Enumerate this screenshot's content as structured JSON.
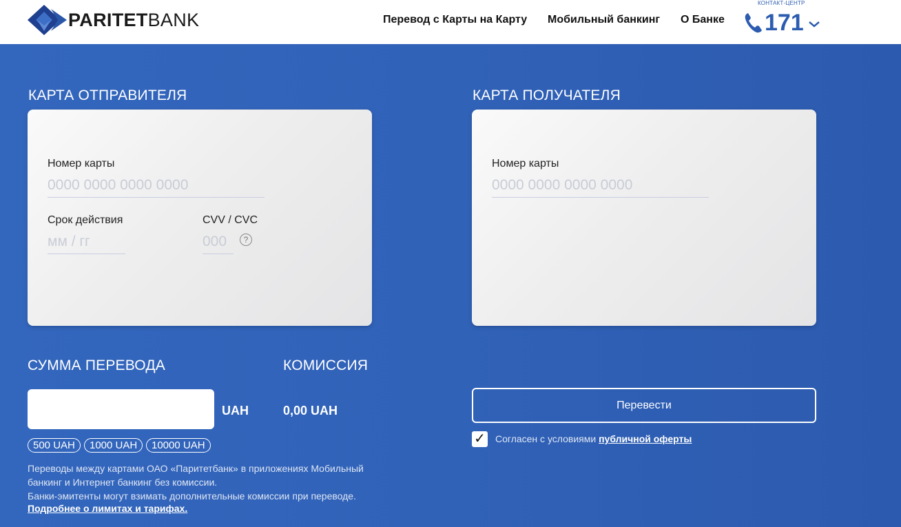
{
  "brand": {
    "name_bold": "PARITET",
    "name_regular": "BANK"
  },
  "nav": [
    {
      "label": "Перевод с Карты на Карту"
    },
    {
      "label": "Мобильный банкинг"
    },
    {
      "label": "О Банке"
    }
  ],
  "contact": {
    "caption": "КОНТАКТ-ЦЕНТР",
    "phone": "171"
  },
  "sender": {
    "title": "КАРТА ОТПРАВИТЕЛЯ",
    "card_number_label": "Номер карты",
    "card_number_placeholder": "0000 0000 0000 0000",
    "expiry_label": "Срок действия",
    "expiry_placeholder": "мм / гг",
    "cvv_label": "CVV / CVC",
    "cvv_placeholder": "000",
    "help_symbol": "?"
  },
  "receiver": {
    "title": "КАРТА ПОЛУЧАТЕЛЯ",
    "card_number_label": "Номер карты",
    "card_number_placeholder": "0000 0000 0000 0000"
  },
  "amount": {
    "title": "СУММА ПЕРЕВОДА",
    "value": "",
    "currency": "UAH",
    "presets": [
      "500 UAH",
      "1000 UAH",
      "10000 UAH"
    ]
  },
  "commission": {
    "title": "КОМИССИЯ",
    "value": "0,00 UAH"
  },
  "notes": {
    "line1": "Переводы между картами ОАО «Паритетбанк» в приложениях Мобильный",
    "line2": "банкинг и Интернет банкинг без комиссии.",
    "line3": "Банки-эмитенты могут взимать дополнительные комиссии при переводе.",
    "link": "Подробнее о лимитах и тарифах."
  },
  "submit_label": "Перевести",
  "agreement": {
    "checked": true,
    "checkmark": "✓",
    "text": "Согласен с условиями",
    "link": "публичной оферты"
  },
  "colors": {
    "background": "#3062b8",
    "accent": "#2c5cb0",
    "logo_dark": "#1f3f8f",
    "logo_light": "#3d6fc7"
  }
}
